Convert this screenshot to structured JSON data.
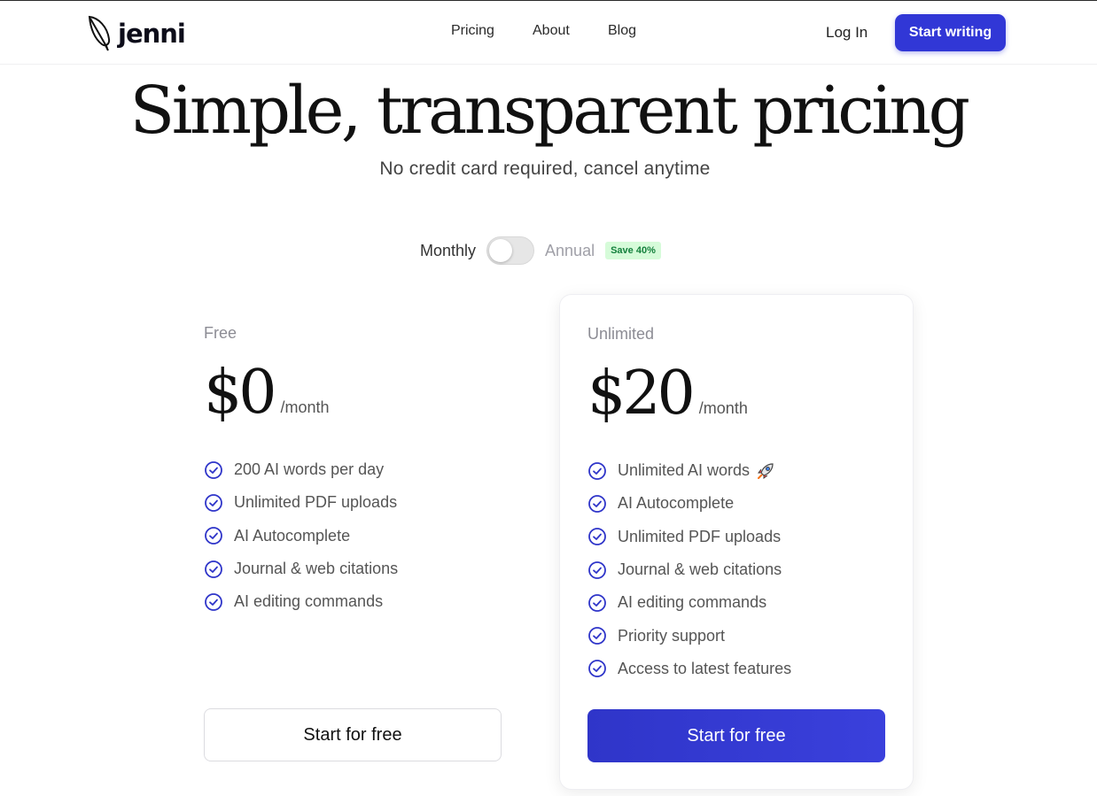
{
  "brand": {
    "name": "jenni"
  },
  "nav": {
    "links": [
      "Pricing",
      "About",
      "Blog"
    ],
    "login": "Log In",
    "cta": "Start writing"
  },
  "hero": {
    "title": "Simple, transparent pricing",
    "subtitle": "No credit card required, cancel anytime"
  },
  "billing": {
    "monthly": "Monthly",
    "annual": "Annual",
    "badge": "Save 40%",
    "annual_selected": false
  },
  "plans": [
    {
      "name": "Free",
      "price": "$0",
      "period": "/month",
      "features": [
        "200 AI words per day",
        "Unlimited PDF uploads",
        "AI Autocomplete",
        "Journal & web citations",
        "AI editing commands"
      ],
      "cta": "Start for free"
    },
    {
      "name": "Unlimited",
      "price": "$20",
      "period": "/month",
      "features": [
        "Unlimited AI words",
        "AI Autocomplete",
        "Unlimited PDF uploads",
        "Journal & web citations",
        "AI editing commands",
        "Priority support",
        "Access to latest features"
      ],
      "cta": "Start for free"
    }
  ],
  "colors": {
    "accent": "#3137d6",
    "check": "#2f35c9",
    "badge_bg": "#d6fbd9",
    "badge_text": "#15803d"
  },
  "icons": {
    "logo": "feather-icon",
    "check": "check-circle-icon",
    "rocket": "rocket-icon"
  }
}
